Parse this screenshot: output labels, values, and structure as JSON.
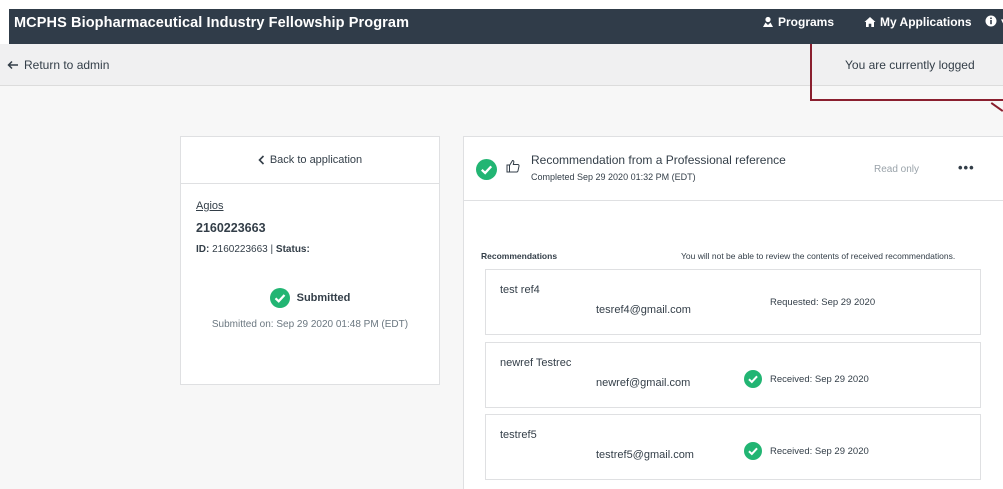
{
  "header": {
    "title": "MCPHS Biopharmaceutical Industry Fellowship Program",
    "nav": {
      "programs": "Programs",
      "my_applications": "My Applications",
      "info_caret": "▾"
    }
  },
  "subbar": {
    "return_label": "Return to admin",
    "logged_in_text": "You are currently logged"
  },
  "application": {
    "back_label": "Back to application",
    "organization": "Agios",
    "app_number": "2160223663",
    "id_label": "ID:",
    "id_value": "2160223663",
    "status_label": "Status:",
    "status": "Submitted",
    "submitted_on": "Submitted on: Sep 29 2020 01:48 PM (EDT)"
  },
  "task": {
    "title": "Recommendation from a Professional reference",
    "completed": "Completed Sep 29 2020 01:32 PM (EDT)",
    "mode": "Read only",
    "more": "•••"
  },
  "recommendations": {
    "label": "Recommendations",
    "note": "You will not be able to review the contents of received recommendations.",
    "items": [
      {
        "name": "test ref4",
        "email": "tesref4@gmail.com",
        "status": "Requested: Sep 29 2020",
        "received": false
      },
      {
        "name": "newref Testrec",
        "email": "newref@gmail.com",
        "status": "Received: Sep 29 2020",
        "received": true
      },
      {
        "name": "testref5",
        "email": "testref5@gmail.com",
        "status": "Received: Sep 29 2020",
        "received": true
      }
    ]
  },
  "colors": {
    "topbar": "#303c49",
    "success": "#22b573",
    "annotation": "#8a1f2e"
  }
}
